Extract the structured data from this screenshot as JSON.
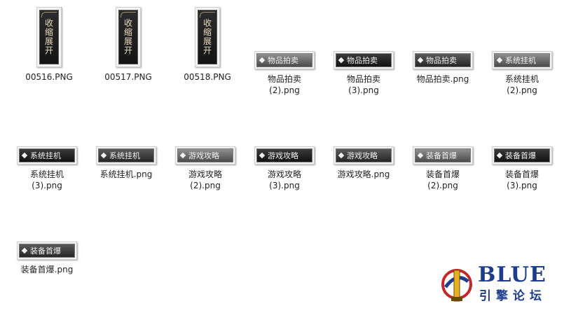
{
  "files": [
    {
      "name": "00516.PNG",
      "kind": "tall",
      "variant": "tall",
      "chars": [
        "收",
        "缩",
        "展",
        "开"
      ]
    },
    {
      "name": "00517.PNG",
      "kind": "tall",
      "variant": "tall",
      "chars": [
        "收",
        "缩",
        "展",
        "开"
      ]
    },
    {
      "name": "00518.PNG",
      "kind": "tall",
      "variant": "tall",
      "chars": [
        "收",
        "缩",
        "展",
        "开"
      ]
    },
    {
      "name": "物品拍卖\n(2).png",
      "kind": "wide",
      "variant": "v-gray",
      "label": "物品拍卖"
    },
    {
      "name": "物品拍卖\n(3).png",
      "kind": "wide",
      "variant": "v-dark",
      "label": "物品拍卖"
    },
    {
      "name": "物品拍卖.png",
      "kind": "wide",
      "variant": "v-mid",
      "label": "物品拍卖"
    },
    {
      "name": "系统挂机\n(2).png",
      "kind": "wide",
      "variant": "v-gray",
      "label": "系统挂机"
    },
    {
      "name": "系统挂机\n(3).png",
      "kind": "wide",
      "variant": "v-dark",
      "label": "系统挂机"
    },
    {
      "name": "系统挂机.png",
      "kind": "wide",
      "variant": "v-mid",
      "label": "系统挂机"
    },
    {
      "name": "游戏攻略\n(2).png",
      "kind": "wide",
      "variant": "v-gray",
      "label": "游戏攻略"
    },
    {
      "name": "游戏攻略\n(3).png",
      "kind": "wide",
      "variant": "v-dark",
      "label": "游戏攻略"
    },
    {
      "name": "游戏攻略.png",
      "kind": "wide",
      "variant": "v-mid",
      "label": "游戏攻略"
    },
    {
      "name": "装备首爆\n(2).png",
      "kind": "wide",
      "variant": "v-gray",
      "label": "装备首爆"
    },
    {
      "name": "装备首爆\n(3).png",
      "kind": "wide",
      "variant": "v-dark",
      "label": "装备首爆"
    },
    {
      "name": "装备首爆.png",
      "kind": "wide",
      "variant": "v-mid",
      "label": "装备首爆"
    }
  ],
  "logo": {
    "title": "BLUE",
    "subtitle": "引擎论坛"
  },
  "colors": {
    "logo_blue": "#1c3c8c",
    "logo_red": "#c0282a",
    "logo_yellow": "#e8b020"
  }
}
